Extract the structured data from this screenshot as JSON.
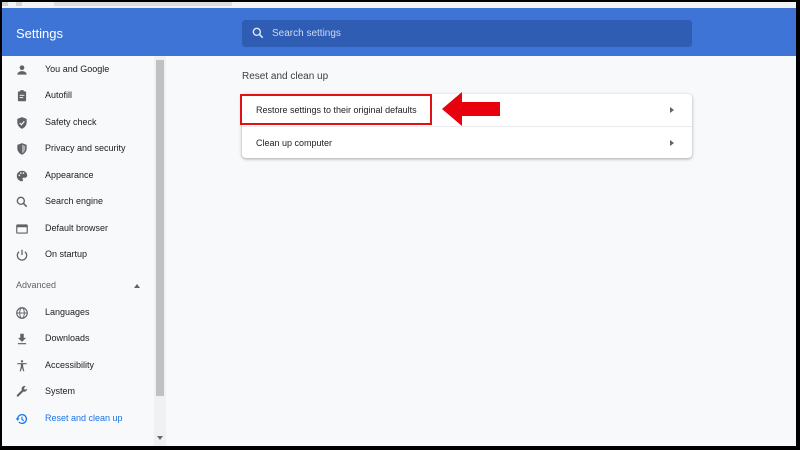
{
  "header": {
    "title": "Settings"
  },
  "search": {
    "placeholder": "Search settings"
  },
  "sidebar": {
    "items": [
      {
        "label": "You and Google",
        "icon": "person-icon"
      },
      {
        "label": "Autofill",
        "icon": "clipboard-icon"
      },
      {
        "label": "Safety check",
        "icon": "shield-check-icon"
      },
      {
        "label": "Privacy and security",
        "icon": "shield-icon"
      },
      {
        "label": "Appearance",
        "icon": "palette-icon"
      },
      {
        "label": "Search engine",
        "icon": "search-icon"
      },
      {
        "label": "Default browser",
        "icon": "browser-icon"
      },
      {
        "label": "On startup",
        "icon": "power-icon"
      }
    ],
    "advanced_label": "Advanced",
    "advanced_items": [
      {
        "label": "Languages",
        "icon": "globe-icon"
      },
      {
        "label": "Downloads",
        "icon": "download-icon"
      },
      {
        "label": "Accessibility",
        "icon": "accessibility-icon"
      },
      {
        "label": "System",
        "icon": "wrench-icon"
      },
      {
        "label": "Reset and clean up",
        "icon": "restore-icon",
        "active": true
      }
    ]
  },
  "main": {
    "section_title": "Reset and clean up",
    "rows": [
      {
        "label": "Restore settings to their original defaults"
      },
      {
        "label": "Clean up computer"
      }
    ]
  },
  "colors": {
    "header": "#3e74d6",
    "search_bg": "#2f5db3",
    "active": "#1a73e8",
    "annotation": "#e01218"
  }
}
